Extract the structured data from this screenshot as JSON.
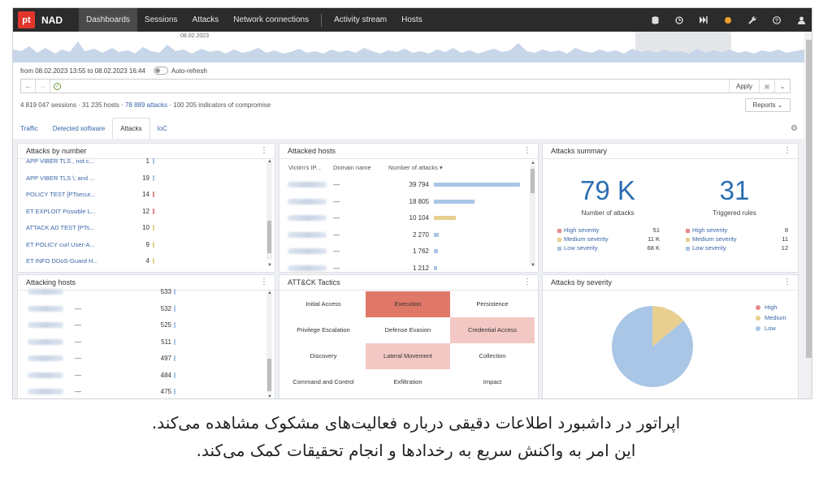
{
  "app": {
    "logo": "pt",
    "brand": "NAD",
    "nav": [
      "Dashboards",
      "Sessions",
      "Attacks",
      "Network connections",
      "Activity stream",
      "Hosts"
    ]
  },
  "timeline": {
    "date_label": "08.02.2023"
  },
  "filter": {
    "range": "from 08.02.2023 13:55 to 08.02.2023 16:44",
    "auto_refresh": "Auto-refresh",
    "apply": "Apply",
    "reports": "Reports"
  },
  "stats": {
    "sessions": "4 819 047 sessions",
    "hosts": "31 235 hosts",
    "attacks": "78 889 attacks",
    "ioc": "100 205 indicators of compromise"
  },
  "tabs": [
    "Traffic",
    "Detected software",
    "Attacks",
    "IoC"
  ],
  "attacks_by_number": {
    "title": "Attacks by number",
    "rows": [
      {
        "name": "APP VIBER TLS , not c...",
        "value": "1"
      },
      {
        "name": "APP VIBER TLS \\; and ...",
        "value": "19"
      },
      {
        "name": "POLICY TEST [PTsecur...",
        "value": "14"
      },
      {
        "name": "ET EXPLOIT Possible L...",
        "value": "12"
      },
      {
        "name": "ATTACK AD TEST [PTs...",
        "value": "10"
      },
      {
        "name": "ET POLICY curl User-A...",
        "value": "9"
      },
      {
        "name": "ET INFO DDoS-Guard H...",
        "value": "4"
      }
    ]
  },
  "attacked_hosts": {
    "title": "Attacked hosts",
    "columns": [
      "Victim's IP...",
      "Domain name",
      "Number of attacks ▾"
    ],
    "rows": [
      {
        "domain": "—",
        "value": "39 794"
      },
      {
        "domain": "—",
        "value": "18 805"
      },
      {
        "domain": "—",
        "value": "10 104"
      },
      {
        "domain": "—",
        "value": "2 270"
      },
      {
        "domain": "—",
        "value": "1 762"
      },
      {
        "domain": "—",
        "value": "1 212"
      }
    ]
  },
  "attacks_summary": {
    "title": "Attacks summary",
    "left": {
      "big": "79 K",
      "label": "Number of attacks",
      "rows": [
        {
          "label": "High severity",
          "value": "51"
        },
        {
          "label": "Medium severity",
          "value": "11 K"
        },
        {
          "label": "Low severity",
          "value": "68 K"
        }
      ]
    },
    "right": {
      "big": "31",
      "label": "Triggered rules",
      "rows": [
        {
          "label": "High severity",
          "value": "8"
        },
        {
          "label": "Medium severity",
          "value": "11"
        },
        {
          "label": "Low severity",
          "value": "12"
        }
      ]
    }
  },
  "attacking_hosts": {
    "title": "Attacking hosts",
    "rows": [
      {
        "domain": "",
        "value": "533"
      },
      {
        "domain": "—",
        "value": "532"
      },
      {
        "domain": "—",
        "value": "525"
      },
      {
        "domain": "—",
        "value": "511"
      },
      {
        "domain": "—",
        "value": "497"
      },
      {
        "domain": "—",
        "value": "484"
      },
      {
        "domain": "—",
        "value": "475"
      }
    ]
  },
  "tactics": {
    "title": "ATT&CK Tactics",
    "cells": [
      "Initial Access",
      "Execution",
      "Persistence",
      "Privilege Escalation",
      "Defense Evasion",
      "Credential Access",
      "Discovery",
      "Lateral Movement",
      "Collection",
      "Command and Control",
      "Exfiltration",
      "Impact"
    ]
  },
  "severity": {
    "title": "Attacks by severity",
    "legend": [
      "High",
      "Medium",
      "Low"
    ],
    "values": [
      51,
      11000,
      68000
    ]
  },
  "colors": {
    "high": "#e8898a",
    "medium": "#e8cf90",
    "low": "#a9c6e6",
    "exec": "#e07868",
    "lighthigh": "#f3c8c4"
  },
  "caption": [
    "اپراتور در داشبورد اطلاعات دقیقی درباره فعالیت‌های مشکوک مشاهده می‌کند.",
    "این امر به واکنش سریع به رخدادها و انجام تحقیقات کمک می‌کند."
  ]
}
